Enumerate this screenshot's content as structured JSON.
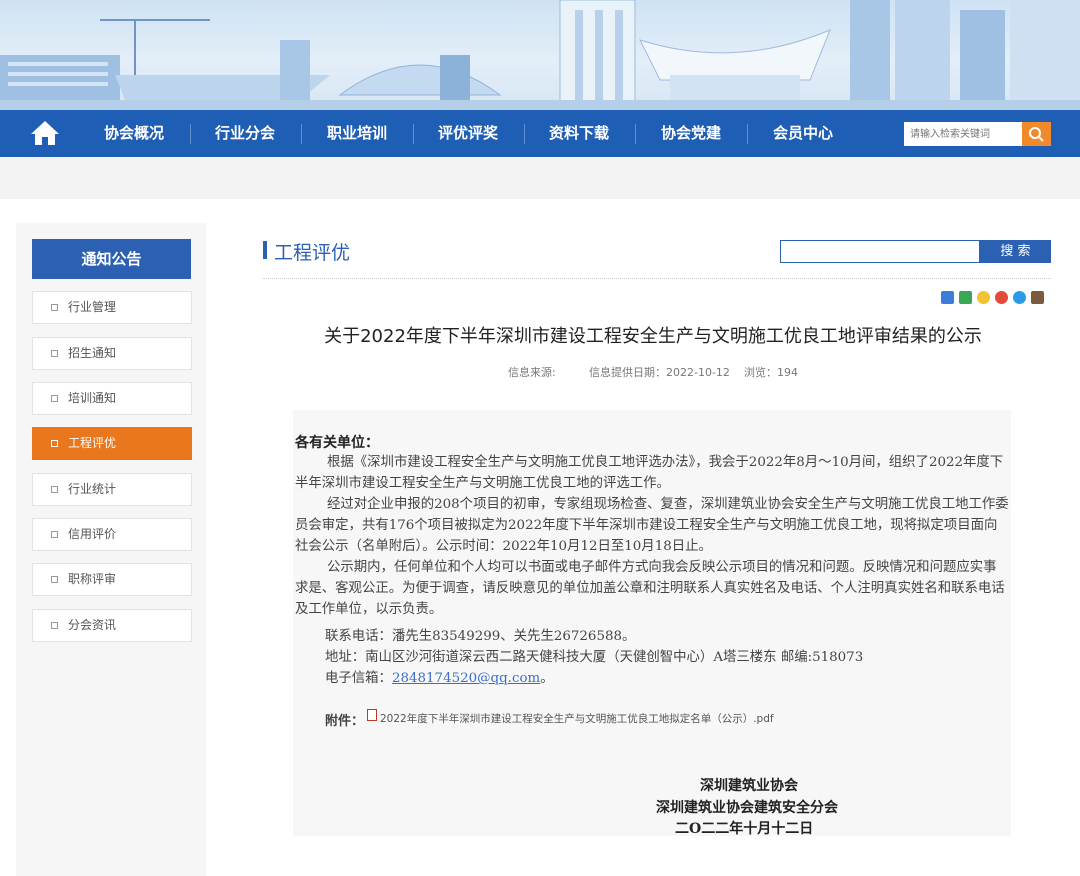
{
  "nav": {
    "items": [
      "协会概况",
      "行业分会",
      "职业培训",
      "评优评奖",
      "资料下载",
      "协会党建",
      "会员中心"
    ],
    "search_placeholder": "请输入检索关键词"
  },
  "sidebar": {
    "heading": "通知公告",
    "items": [
      "行业管理",
      "招生通知",
      "培训通知",
      "工程评优",
      "行业统计",
      "信用评价",
      "职称评审",
      "分会资讯"
    ],
    "active_index": 3
  },
  "main": {
    "section_title": "工程评优",
    "search_button": "搜 索"
  },
  "article": {
    "title": "关于2022年度下半年深圳市建设工程安全生产与文明施工优良工地评审结果的公示",
    "meta_source": "信息来源:",
    "meta_date": "信息提供日期：2022-10-12",
    "meta_views": "浏览：194",
    "salutation": "各有关单位：",
    "p1": "根据《深圳市建设工程安全生产与文明施工优良工地评选办法》，我会于2022年8月～10月间，组织了2022年度下半年深圳市建设工程安全生产与文明施工优良工地的评选工作。",
    "p2": "经过对企业申报的208个项目的初审，专家组现场检查、复查，深圳建筑业协会安全生产与文明施工优良工地工作委员会审定，共有176个项目被拟定为2022年度下半年深圳市建设工程安全生产与文明施工优良工地，现将拟定项目面向社会公示（名单附后）。公示时间：2022年10月12日至10月18日止。",
    "p3": "公示期内，任何单位和个人均可以书面或电子邮件方式向我会反映公示项目的情况和问题。反映情况和问题应实事求是、客观公正。为便于调查，请反映意见的单位加盖公章和注明联系人真实姓名及电话、个人注明真实姓名和联系电话及工作单位，以示负责。",
    "contact": "联系电话：潘先生83549299、关先生26726588。",
    "address": "地址：南山区沙河街道深云西二路天健科技大厦（天健创智中心）A塔三楼东  邮编:518073",
    "email_label": "电子信箱：",
    "email": "2848174520@qq.com",
    "email_suffix": "。",
    "attach_label": "附件：",
    "attach_file": "2022年度下半年深圳市建设工程安全生产与文明施工优良工地拟定名单（公示）.pdf",
    "sign1": "深圳建筑业协会",
    "sign2": "深圳建筑业协会建筑安全分会",
    "sign_date": "二O二二年十月十二日"
  },
  "colors": {
    "nav_blue": "#1e5eb4",
    "accent_orange": "#e8771d",
    "title_blue": "#2c60b3"
  }
}
